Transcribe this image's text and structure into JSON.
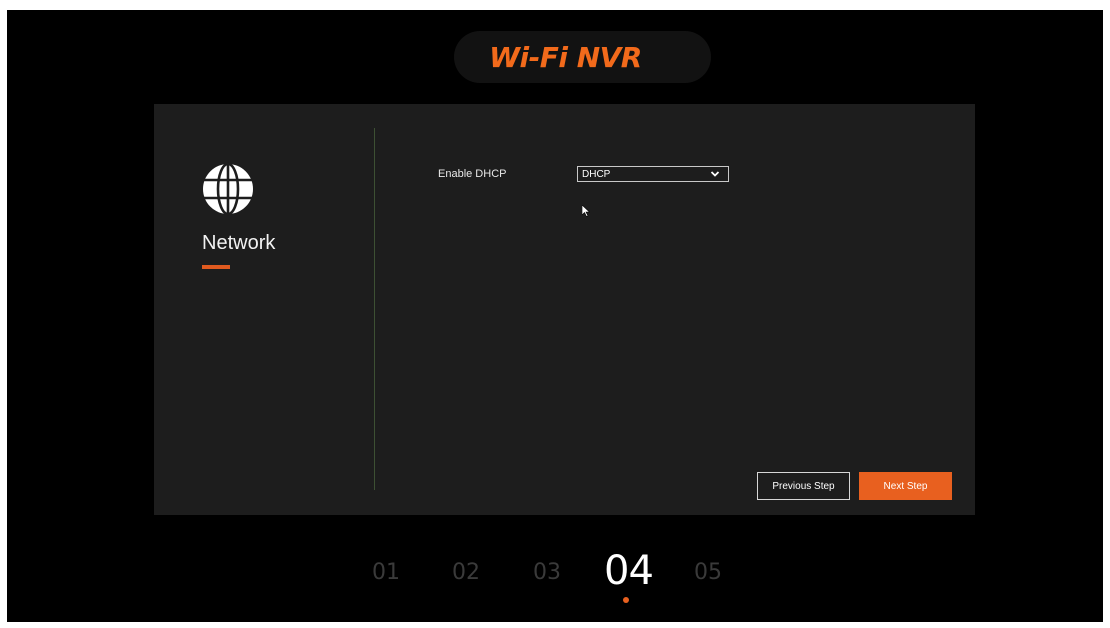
{
  "header": {
    "brand_title": "Wi-Fi NVR"
  },
  "sidebar": {
    "icon": "globe-icon",
    "title": "Network"
  },
  "form": {
    "dhcp": {
      "label": "Enable DHCP",
      "value": "DHCP"
    }
  },
  "actions": {
    "previous_label": "Previous Step",
    "next_label": "Next Step"
  },
  "steps": {
    "items": [
      "01",
      "02",
      "03",
      "04",
      "05"
    ],
    "active_index": 3
  },
  "colors": {
    "accent": "#e8601f",
    "brand": "#f26a1b",
    "panel_bg": "#1d1d1d",
    "screen_bg": "#000000"
  }
}
